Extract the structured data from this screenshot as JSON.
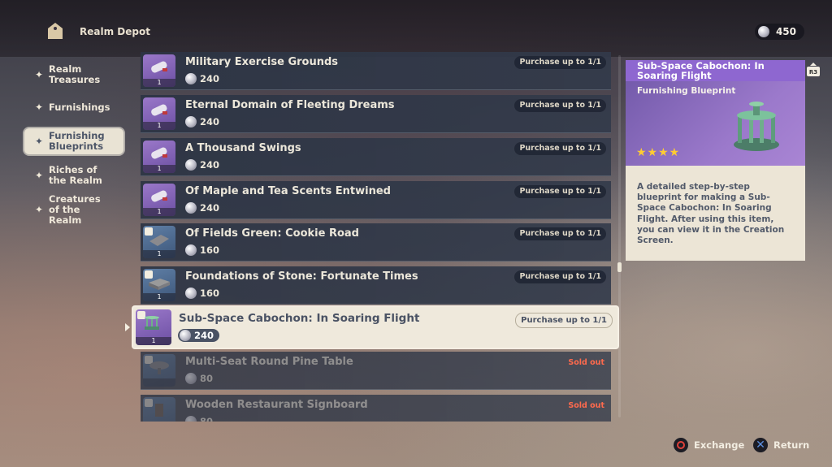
{
  "header": {
    "title": "Realm Depot",
    "currency_amount": "450"
  },
  "sidebar": {
    "items": [
      {
        "label": "Realm Treasures"
      },
      {
        "label": "Furnishings"
      },
      {
        "label": "Furnishing Blueprints"
      },
      {
        "label": "Riches of the Realm"
      },
      {
        "label": "Creatures of the Realm"
      }
    ]
  },
  "items": [
    {
      "name": "Military Exercise Grounds",
      "price": "240",
      "status": "Purchase up to 1/1",
      "qty": "1",
      "thumb": "blueprint-scroll"
    },
    {
      "name": "Eternal Domain of Fleeting Dreams",
      "price": "240",
      "status": "Purchase up to 1/1",
      "qty": "1",
      "thumb": "blueprint-scroll"
    },
    {
      "name": "A Thousand Swings",
      "price": "240",
      "status": "Purchase up to 1/1",
      "qty": "1",
      "thumb": "blueprint-scroll"
    },
    {
      "name": "Of Maple and Tea Scents Entwined",
      "price": "240",
      "status": "Purchase up to 1/1",
      "qty": "1",
      "thumb": "blueprint-scroll"
    },
    {
      "name": "Of Fields Green: Cookie Road",
      "price": "160",
      "status": "Purchase up to 1/1",
      "qty": "1",
      "thumb": "cookie-road"
    },
    {
      "name": "Foundations of Stone: Fortunate Times",
      "price": "160",
      "status": "Purchase up to 1/1",
      "qty": "1",
      "thumb": "stone-foundation"
    },
    {
      "name": "Sub-Space Cabochon: In Soaring Flight",
      "price": "240",
      "status": "Purchase up to 1/1",
      "qty": "1",
      "thumb": "cabochon"
    },
    {
      "name": "Multi-Seat Round Pine Table",
      "price": "80",
      "status": "Sold out",
      "qty": "",
      "thumb": "round-table"
    },
    {
      "name": "Wooden Restaurant Signboard",
      "price": "80",
      "status": "Sold out",
      "qty": "",
      "thumb": "signboard"
    }
  ],
  "detail": {
    "title": "Sub-Space Cabochon: In Soaring Flight",
    "type": "Furnishing Blueprint",
    "rarity_stars": 4,
    "stars_text": "★★★★",
    "description": "A detailed step-by-step blueprint for making a Sub-Space Cabochon: In Soaring Flight. After using this item, you can view it in the Creation Screen."
  },
  "footer": {
    "exchange_label": "Exchange",
    "return_label": "Return"
  },
  "colors": {
    "accent_purple": "#9b79cb",
    "sold_out": "#ff6a4d",
    "star": "#ffcc32",
    "selected_bg": "#efe9dc"
  }
}
